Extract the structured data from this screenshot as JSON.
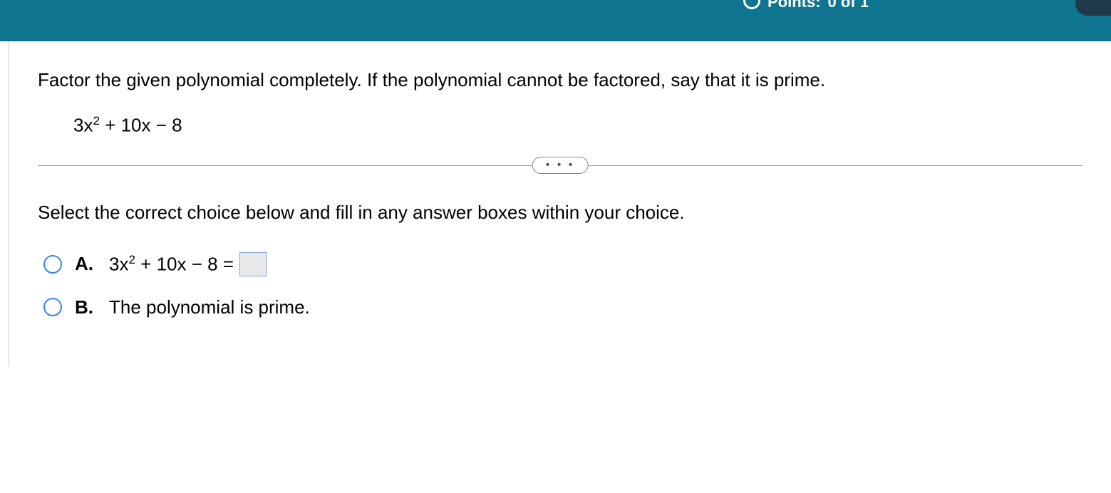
{
  "header": {
    "points_label": "Points:",
    "points_value": "0 of 1"
  },
  "question": {
    "prompt": "Factor the given polynomial completely.  If the polynomial cannot be factored, say that it is prime.",
    "polynomial_base1": "3x",
    "polynomial_exp1": "2",
    "polynomial_rest": " + 10x − 8"
  },
  "divider": {
    "ellipsis": "• • •"
  },
  "instruction": "Select the correct choice below and fill in any answer boxes within your choice.",
  "choices": {
    "a": {
      "label": "A.",
      "expr_base1": "3x",
      "expr_exp1": "2",
      "expr_rest": " + 10x − 8 = "
    },
    "b": {
      "label": "B.",
      "text": "The polynomial is prime."
    }
  }
}
